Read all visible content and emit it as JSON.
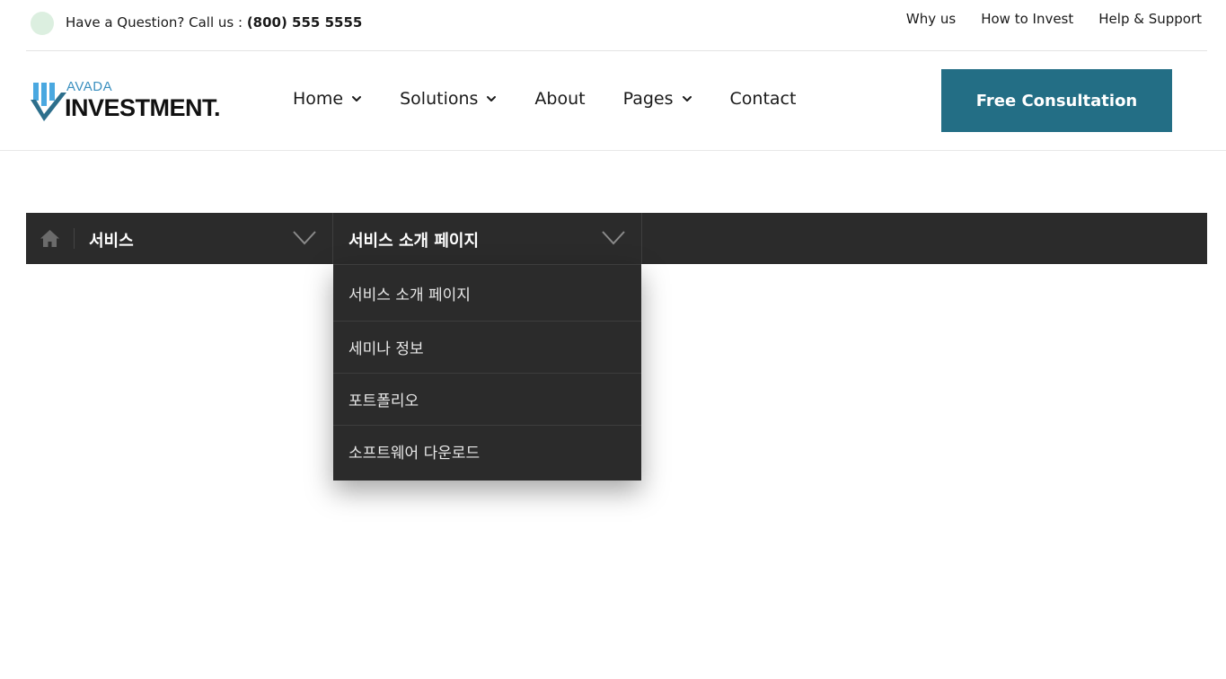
{
  "topbar": {
    "question_prefix": "Have a Question? Call us : ",
    "phone": "(800) 555 5555",
    "links": [
      "Why us",
      "How to Invest",
      "Help & Support"
    ]
  },
  "logo": {
    "small": "AVADA",
    "large": "INVESTMENT."
  },
  "nav": {
    "items": [
      {
        "label": "Home",
        "has_dropdown": true
      },
      {
        "label": "Solutions",
        "has_dropdown": true
      },
      {
        "label": "About",
        "has_dropdown": false
      },
      {
        "label": "Pages",
        "has_dropdown": true
      },
      {
        "label": "Contact",
        "has_dropdown": false
      }
    ],
    "cta_label": "Free Consultation"
  },
  "breadcrumb": {
    "home_icon": "home-icon",
    "level1": "서비스",
    "level2": "서비스 소개 페이지"
  },
  "dropdown": {
    "items": [
      "서비스 소개 페이지",
      "세미나 정보",
      "포트폴리오",
      "소프트웨어 다운로드"
    ]
  },
  "colors": {
    "cta_bg": "#236e85",
    "bar_bg": "#2b2b2b",
    "logo_blue": "#3a8fbf",
    "dot": "#dcefe0"
  }
}
